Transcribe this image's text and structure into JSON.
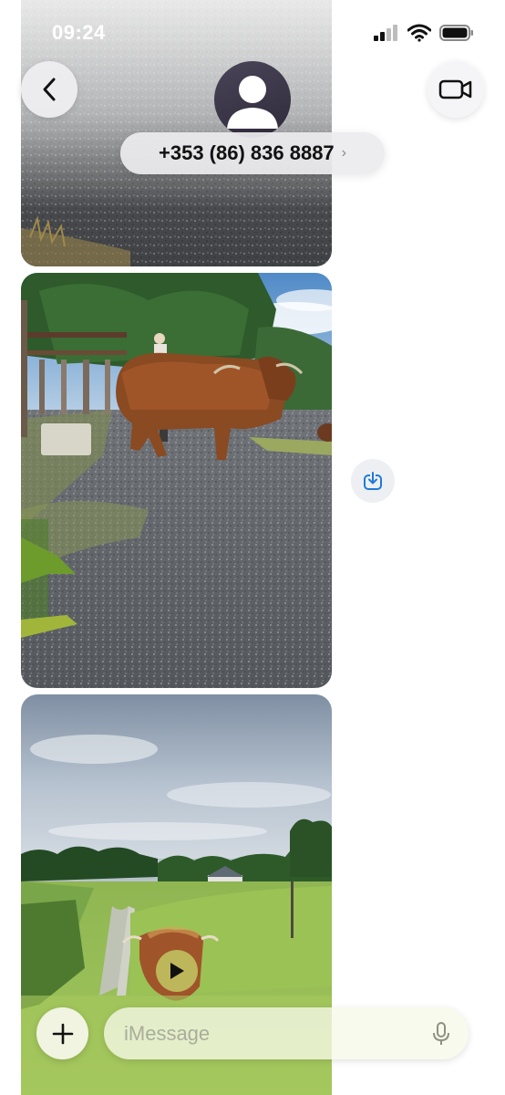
{
  "status_bar": {
    "time": "09:24"
  },
  "header": {
    "contact": "+353 (86) 836 8887"
  },
  "composer": {
    "placeholder": "iMessage"
  },
  "icons": {
    "back": "chevron-left-icon",
    "video": "video-camera-icon",
    "avatar": "person-icon",
    "save": "save-to-photos-icon",
    "add": "plus-icon",
    "mic": "microphone-icon",
    "play": "play-icon"
  },
  "colors": {
    "accent": "#1e7bd8",
    "avatar_bg": "#3a3447"
  }
}
